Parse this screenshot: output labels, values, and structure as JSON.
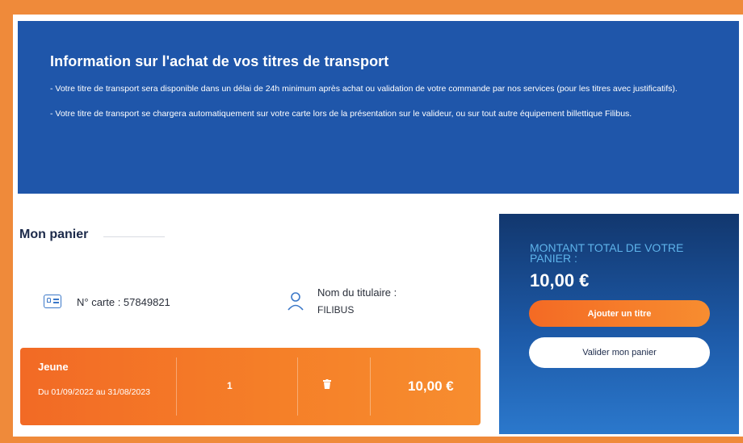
{
  "info": {
    "title": "Information sur l'achat de vos titres de transport",
    "paragraph1": "- Votre titre de transport sera disponible dans un délai de 24h minimum après achat ou validation de votre commande par nos services (pour les titres avec justificatifs).",
    "paragraph2": "- Votre titre de transport se chargera automatiquement sur votre carte lors de la présentation sur le valideur, ou sur tout autre équipement billettique Filibus."
  },
  "cart": {
    "title": "Mon panier",
    "card_number": "N° carte : 57849821",
    "holder_label": "Nom du titulaire :",
    "holder_name": "FILIBUS",
    "items": [
      {
        "name": "Jeune",
        "dates": "Du 01/09/2022 au 31/08/2023",
        "quantity": "1",
        "price": "10,00 €"
      }
    ]
  },
  "summary": {
    "total_label": "MONTANT TOTAL DE VOTRE PANIER :",
    "total_amount": "10,00 €",
    "add_button": "Ajouter un titre",
    "validate_button": "Valider mon panier"
  },
  "colors": {
    "frame_border": "#ef8a3a",
    "info_background": "#1f56aa",
    "accent_orange": "#f57f28",
    "total_label": "#5eb3ea",
    "icon_blue": "#3b78c8"
  },
  "icons": [
    "id-card-icon",
    "person-icon",
    "trash-icon"
  ]
}
